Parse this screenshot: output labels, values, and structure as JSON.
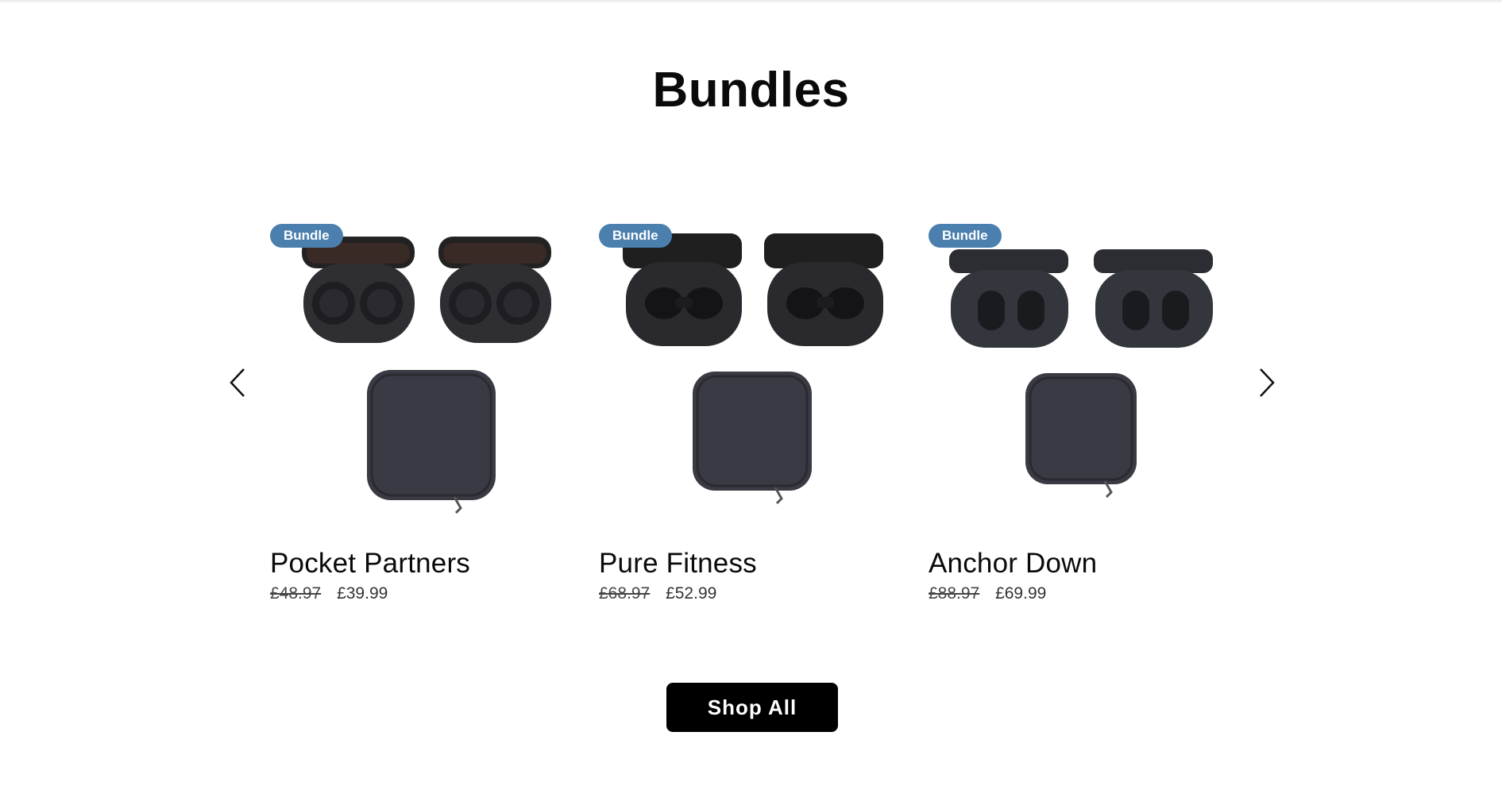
{
  "section": {
    "title": "Bundles"
  },
  "carousel": {
    "prev_icon": "chevron-left-icon",
    "next_icon": "chevron-right-icon",
    "products": [
      {
        "badge": "Bundle",
        "name": "Pocket Partners",
        "old_price": "£48.97",
        "price": "£39.99",
        "image_icon": "earbuds-bundle-image",
        "case_lid_color": "#2a2526"
      },
      {
        "badge": "Bundle",
        "name": "Pure Fitness",
        "old_price": "£68.97",
        "price": "£52.99",
        "image_icon": "earbuds-bundle-image",
        "case_lid_color": "#1f1f1f"
      },
      {
        "badge": "Bundle",
        "name": "Anchor Down",
        "old_price": "£88.97",
        "price": "£69.99",
        "image_icon": "earbuds-bundle-image",
        "case_lid_color": "#2b2d33"
      }
    ]
  },
  "cta": {
    "label": "Shop All"
  },
  "colors": {
    "badge_bg": "#4a7fae",
    "cta_bg": "#000000",
    "case_dark": "#2e2e33",
    "pouch": "#3a3a44"
  }
}
